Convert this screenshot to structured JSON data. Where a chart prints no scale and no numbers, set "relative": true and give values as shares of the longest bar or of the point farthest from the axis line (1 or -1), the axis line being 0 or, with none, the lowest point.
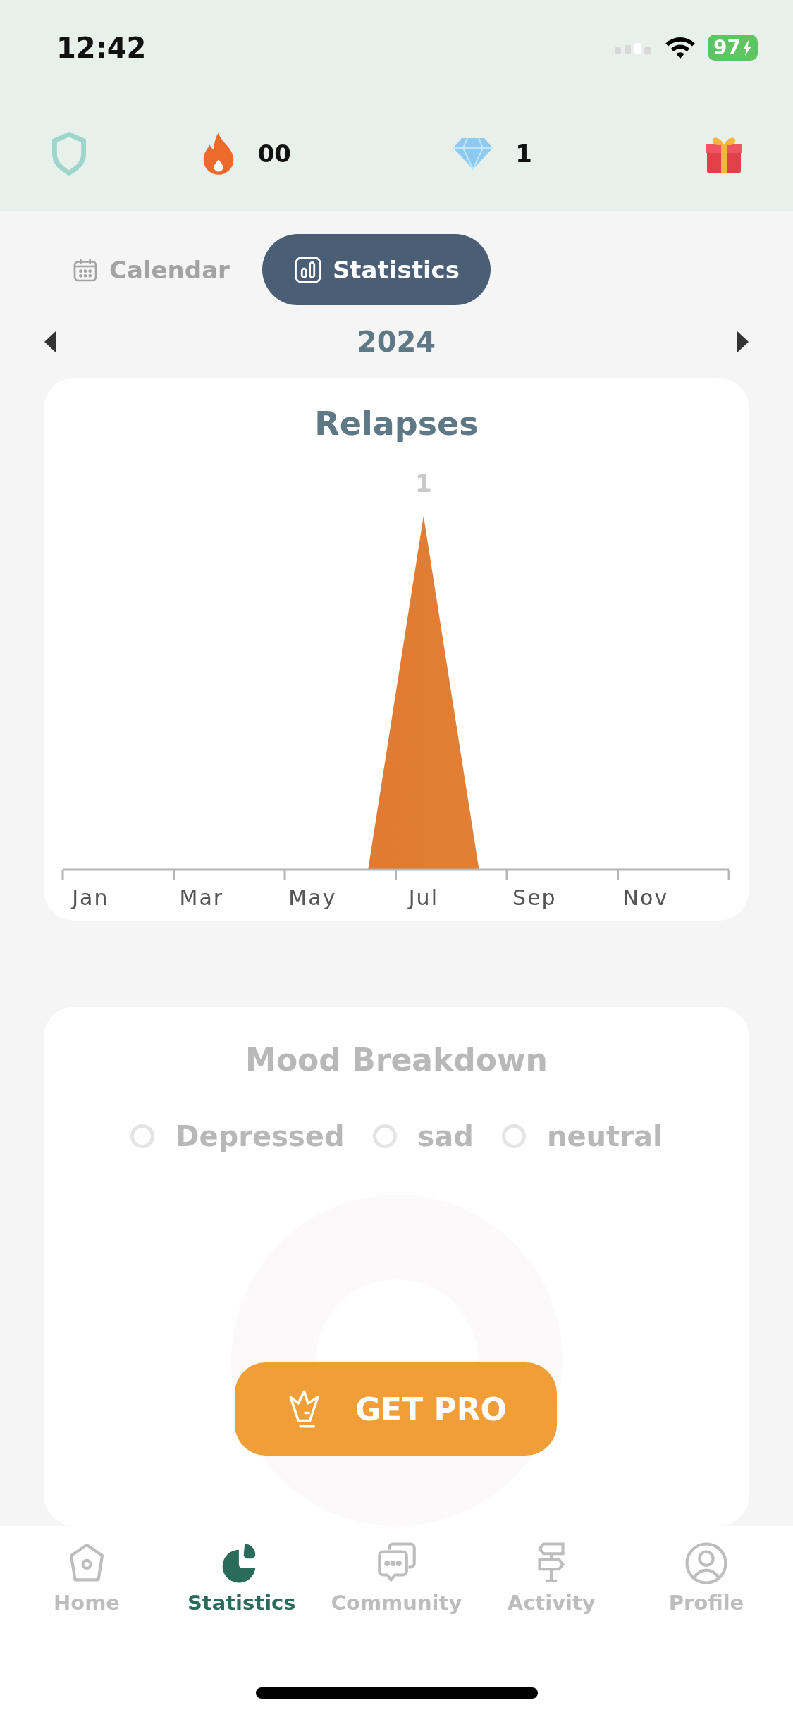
{
  "status_bar": {
    "time": "12:42",
    "battery": "97"
  },
  "header": {
    "streak": "00",
    "gems": "1"
  },
  "tabs": [
    {
      "label": "Calendar",
      "selected": false,
      "kind": "calendar"
    },
    {
      "label": "Statistics",
      "selected": true,
      "kind": "statistics"
    }
  ],
  "year": "2024",
  "relapses": {
    "title": "Relapses",
    "chart_data": {
      "type": "area",
      "relative": true,
      "categories": [
        "Jan",
        null,
        "Mar",
        null,
        "May",
        null,
        "Jul",
        null,
        "Sep",
        null,
        "Nov",
        null
      ],
      "value_labels": [
        null,
        null,
        null,
        null,
        null,
        null,
        "1",
        null,
        null,
        null,
        null,
        null
      ],
      "series": [
        {
          "color": "#dd6a30",
          "values": [
            0,
            0,
            0,
            0,
            0,
            0,
            1,
            0,
            0,
            0,
            0,
            0
          ]
        }
      ]
    }
  },
  "mood": {
    "title": "Mood Breakdown",
    "legend": [
      "Depressed",
      "sad",
      "neutral"
    ]
  },
  "pro_button": {
    "label": "GET PRO"
  },
  "nav": [
    {
      "label": "Home",
      "selected": false,
      "kind": "home"
    },
    {
      "label": "Statistics",
      "selected": true,
      "kind": "statistics"
    },
    {
      "label": "Community",
      "selected": false,
      "kind": "community"
    },
    {
      "label": "Activity",
      "selected": false,
      "kind": "activity"
    },
    {
      "label": "Profile",
      "selected": false,
      "kind": "profile"
    }
  ]
}
